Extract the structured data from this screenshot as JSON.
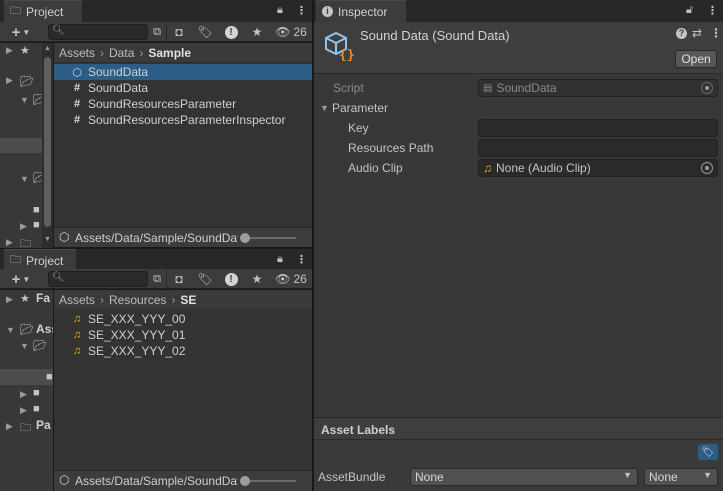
{
  "project_top": {
    "tab_label": "Project",
    "hidden_count": "26",
    "breadcrumb": [
      "Assets",
      "Data",
      "Sample"
    ],
    "assets": [
      {
        "name": "SoundData",
        "icon": "scriptable-object-icon",
        "selected": true
      },
      {
        "name": "SoundData",
        "icon": "csharp-script-icon",
        "selected": false
      },
      {
        "name": "SoundResourcesParameter",
        "icon": "csharp-script-icon",
        "selected": false
      },
      {
        "name": "SoundResourcesParameterInspector",
        "icon": "csharp-script-icon",
        "selected": false
      }
    ],
    "footer_path": "Assets/Data/Sample/SoundData"
  },
  "project_bottom": {
    "tab_label": "Project",
    "hidden_count": "26",
    "tree_labels": [
      "Fa",
      "Ass",
      "Pa"
    ],
    "breadcrumb": [
      "Assets",
      "Resources",
      "SE"
    ],
    "assets": [
      {
        "name": "SE_XXX_YYY_00",
        "icon": "audio-clip-icon"
      },
      {
        "name": "SE_XXX_YYY_01",
        "icon": "audio-clip-icon"
      },
      {
        "name": "SE_XXX_YYY_02",
        "icon": "audio-clip-icon"
      }
    ],
    "footer_path": "Assets/Data/Sample/SoundData"
  },
  "inspector": {
    "tab_label": "Inspector",
    "title": "Sound Data (Sound Data)",
    "open_button": "Open",
    "script_label": "Script",
    "script_value": "SoundData",
    "section_label": "Parameter",
    "fields": [
      {
        "label": "Key",
        "value": ""
      },
      {
        "label": "Resources Path",
        "value": ""
      },
      {
        "label": "Audio Clip",
        "value": "None (Audio Clip)"
      }
    ],
    "asset_labels_title": "Asset Labels",
    "assetbundle_label": "AssetBundle",
    "assetbundle_value": "None",
    "assetbundle_variant": "None"
  }
}
